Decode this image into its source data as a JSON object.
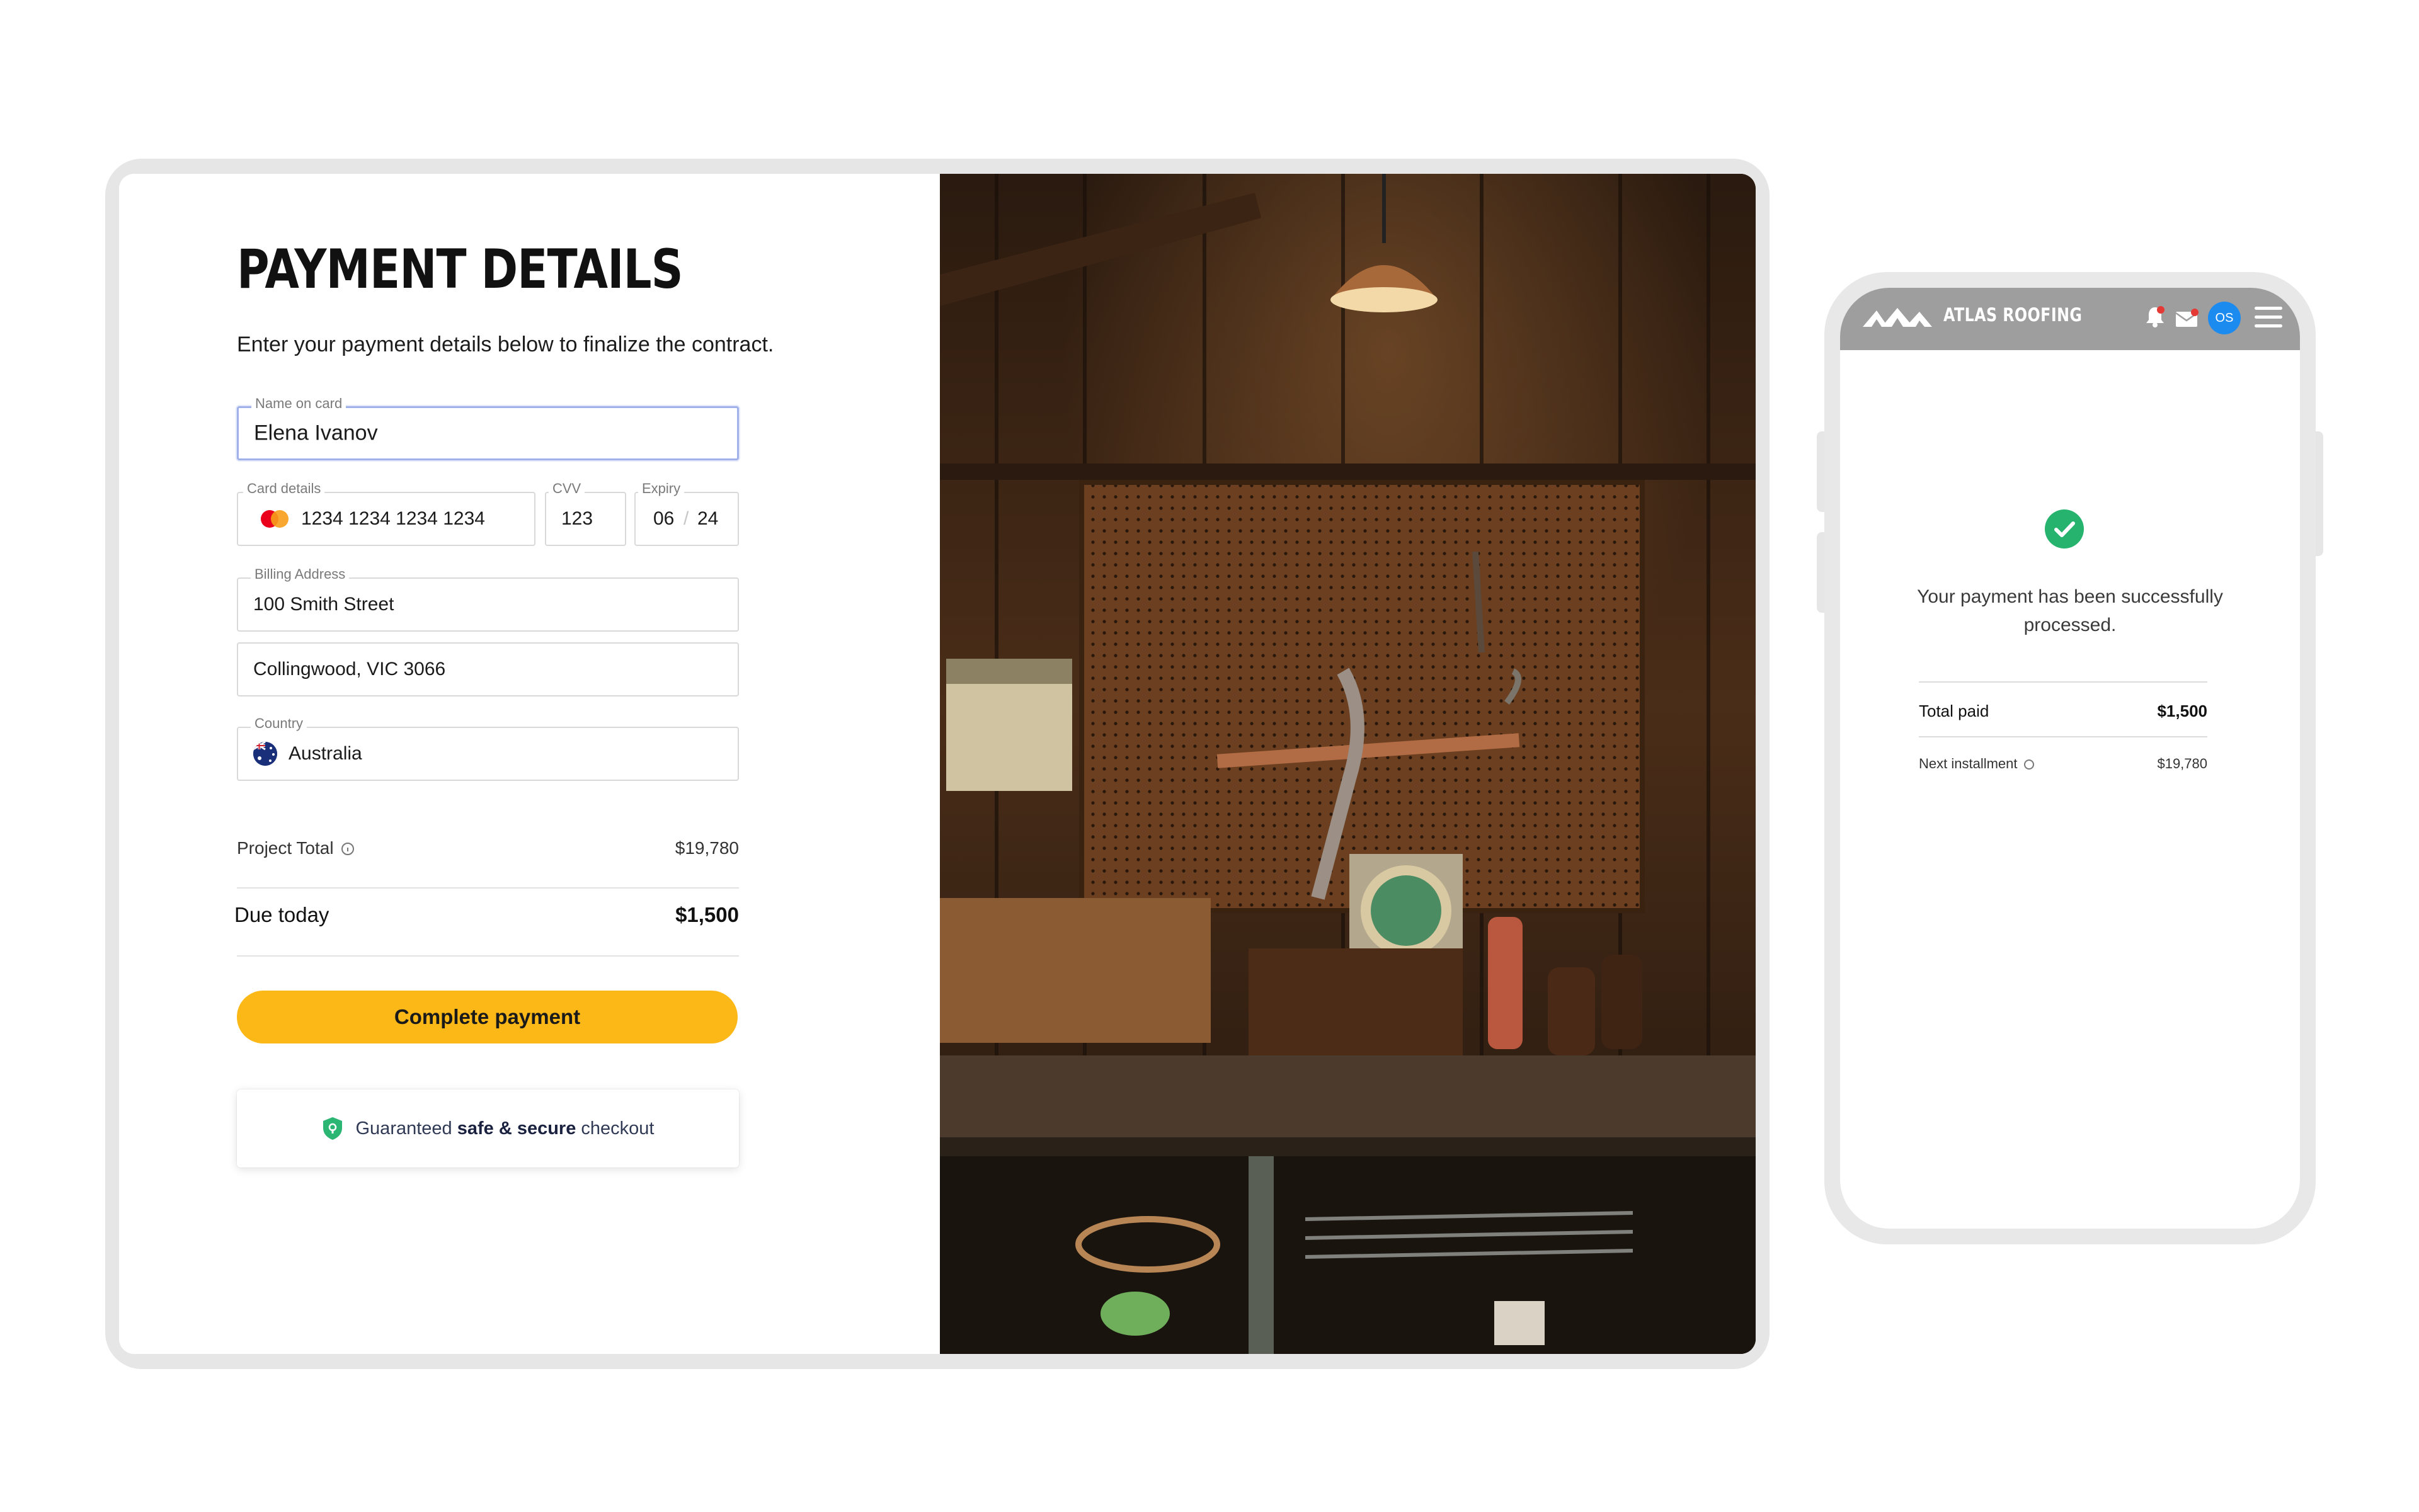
{
  "desktop": {
    "title": "PAYMENT DETAILS",
    "subtitle": "Enter your payment details below to finalize the contract.",
    "fields": {
      "name_label": "Name on card",
      "name_value": "Elena Ivanov",
      "card_label": "Card details",
      "card_value": "1234 1234 1234 1234",
      "cvv_label": "CVV",
      "cvv_value": "123",
      "expiry_label": "Expiry",
      "expiry_month": "06",
      "expiry_sep": "/",
      "expiry_year": "24",
      "billing_label": "Billing Address",
      "billing_line1": "100 Smith Street",
      "billing_line2": "Collingwood, VIC 3066",
      "country_label": "Country",
      "country_value": "Australia"
    },
    "summary": {
      "project_total_label": "Project Total",
      "project_total_value": "$19,780",
      "due_today_label": "Due today",
      "due_today_value": "$1,500"
    },
    "pay_button": "Complete payment",
    "secure": {
      "prefix": "Guaranteed ",
      "bold": "safe & secure",
      "suffix": " checkout"
    },
    "colors": {
      "button": "#fbb817",
      "shield": "#2bb673",
      "focus_border": "#9fb1e8"
    }
  },
  "phone": {
    "brand": "ATLAS ROOFING",
    "avatar_initials": "OS",
    "icons": [
      "bell-icon",
      "mail-icon",
      "menu-icon"
    ],
    "success_message": "Your payment has been successfully processed.",
    "total_paid_label": "Total paid",
    "total_paid_value": "$1,500",
    "next_installment_label": "Next installment",
    "next_installment_value": "$19,780",
    "colors": {
      "header": "#9e9e9e",
      "avatar": "#1c8bf0",
      "success": "#25b36d"
    }
  }
}
